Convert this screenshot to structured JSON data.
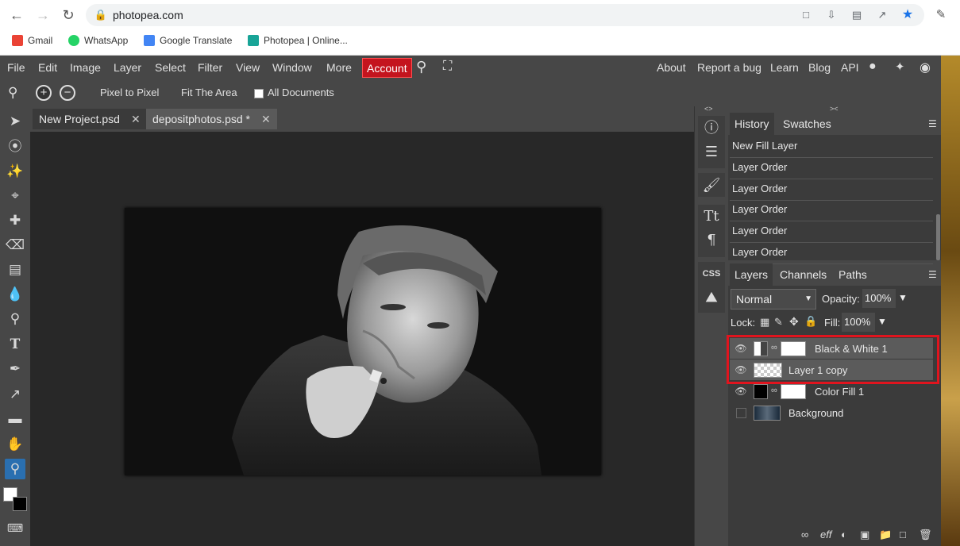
{
  "browser": {
    "url": "photopea.com",
    "bookmarks": [
      "Gmail",
      "WhatsApp",
      "Google Translate",
      "Photopea | Online..."
    ]
  },
  "menubar": {
    "items": [
      "File",
      "Edit",
      "Image",
      "Layer",
      "Select",
      "Filter",
      "View",
      "Window",
      "More"
    ],
    "account": "Account",
    "right_links": [
      "About",
      "Report a bug",
      "Learn",
      "Blog",
      "API"
    ]
  },
  "optbar": {
    "pixel_to_pixel": "Pixel to Pixel",
    "fit_area": "Fit The Area",
    "all_documents": "All Documents"
  },
  "tabs": [
    {
      "label": "New Project.psd"
    },
    {
      "label": "depositphotos.psd *"
    }
  ],
  "history": {
    "tab_history": "History",
    "tab_swatches": "Swatches",
    "items": [
      "New Fill Layer",
      "Layer Order",
      "Layer Order",
      "Layer Order",
      "Layer Order",
      "Layer Order"
    ]
  },
  "layers": {
    "tab_layers": "Layers",
    "tab_channels": "Channels",
    "tab_paths": "Paths",
    "blend_mode": "Normal",
    "opacity_label": "Opacity:",
    "opacity": "100%",
    "lock_label": "Lock:",
    "fill_label": "Fill:",
    "fill": "100%",
    "rows": [
      {
        "name": "Black & White 1"
      },
      {
        "name": "Layer 1 copy"
      },
      {
        "name": "Color Fill 1"
      },
      {
        "name": "Background"
      }
    ]
  },
  "colors": {
    "highlight": "#e0141e",
    "account_bg": "#c4141e"
  }
}
